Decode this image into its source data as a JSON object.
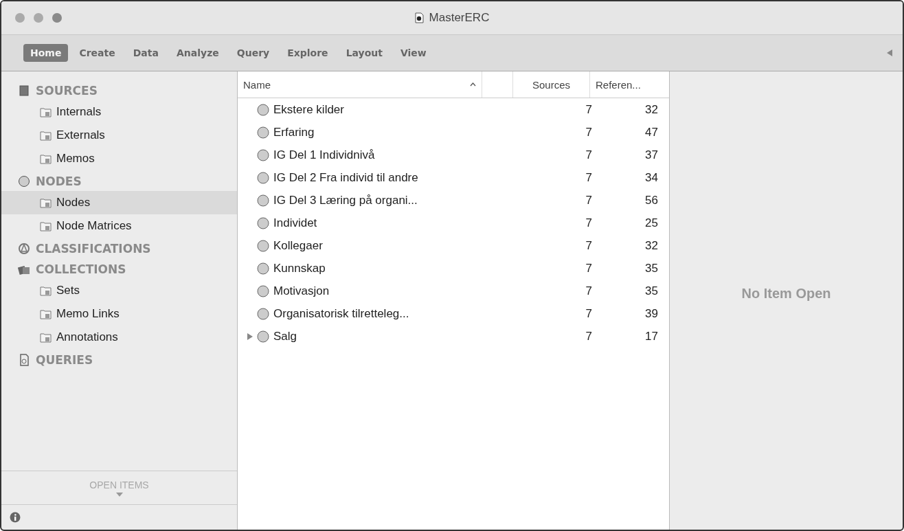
{
  "window": {
    "title": "MasterERC"
  },
  "tabs": [
    {
      "label": "Home",
      "selected": true
    },
    {
      "label": "Create",
      "selected": false
    },
    {
      "label": "Data",
      "selected": false
    },
    {
      "label": "Analyze",
      "selected": false
    },
    {
      "label": "Query",
      "selected": false
    },
    {
      "label": "Explore",
      "selected": false
    },
    {
      "label": "Layout",
      "selected": false
    },
    {
      "label": "View",
      "selected": false
    }
  ],
  "sidebar": {
    "sections": [
      {
        "label": "SOURCES",
        "items": [
          {
            "label": "Internals",
            "selected": false
          },
          {
            "label": "Externals",
            "selected": false
          },
          {
            "label": "Memos",
            "selected": false
          }
        ]
      },
      {
        "label": "NODES",
        "items": [
          {
            "label": "Nodes",
            "selected": true
          },
          {
            "label": "Node Matrices",
            "selected": false
          }
        ]
      },
      {
        "label": "CLASSIFICATIONS"
      },
      {
        "label": "COLLECTIONS",
        "items": [
          {
            "label": "Sets",
            "selected": false
          },
          {
            "label": "Memo Links",
            "selected": false
          },
          {
            "label": "Annotations",
            "selected": false
          }
        ]
      },
      {
        "label": "QUERIES"
      }
    ],
    "open_items": "OPEN ITEMS"
  },
  "table": {
    "columns": [
      "Name",
      "Sources",
      "Referen..."
    ],
    "rows": [
      {
        "name": "Ekstere kilder",
        "sources": "7",
        "references": "32",
        "expandable": false
      },
      {
        "name": "Erfaring",
        "sources": "7",
        "references": "47",
        "expandable": false
      },
      {
        "name": "IG Del 1 Individnivå",
        "sources": "7",
        "references": "37",
        "expandable": false
      },
      {
        "name": "IG Del 2 Fra individ til andre",
        "sources": "7",
        "references": "34",
        "expandable": false
      },
      {
        "name": "IG Del 3 Læring på organi...",
        "sources": "7",
        "references": "56",
        "expandable": false
      },
      {
        "name": "Individet",
        "sources": "7",
        "references": "25",
        "expandable": false
      },
      {
        "name": "Kollegaer",
        "sources": "7",
        "references": "32",
        "expandable": false
      },
      {
        "name": "Kunnskap",
        "sources": "7",
        "references": "35",
        "expandable": false
      },
      {
        "name": "Motivasjon",
        "sources": "7",
        "references": "35",
        "expandable": false
      },
      {
        "name": "Organisatorisk tilretteleg...",
        "sources": "7",
        "references": "39",
        "expandable": false
      },
      {
        "name": "Salg",
        "sources": "7",
        "references": "17",
        "expandable": true
      }
    ]
  },
  "detail": {
    "message": "No Item Open"
  }
}
